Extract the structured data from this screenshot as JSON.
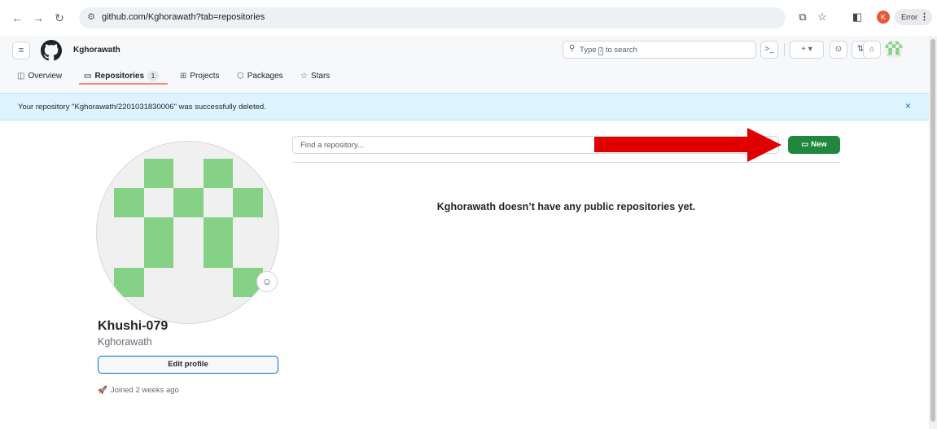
{
  "browser": {
    "url": "github.com/Kghorawath?tab=repositories",
    "profile_initial": "K",
    "error_label": "Error",
    "icons": [
      "back-icon",
      "forward-icon",
      "reload-icon",
      "site-info-icon",
      "install-app-icon",
      "bookmark-star-icon",
      "side-panel-icon",
      "menu-dots-icon"
    ]
  },
  "header": {
    "username": "Kghorawath",
    "search_label": "Type",
    "search_key": "/",
    "search_suffix": "to search",
    "create_label": "+ ▾"
  },
  "tabs": [
    {
      "label": "Overview",
      "icon": "book-icon"
    },
    {
      "label": "Repositories",
      "icon": "repo-icon",
      "count": "1"
    },
    {
      "label": "Projects",
      "icon": "table-icon"
    },
    {
      "label": "Packages",
      "icon": "package-icon"
    },
    {
      "label": "Stars",
      "icon": "star-icon"
    }
  ],
  "flash": {
    "message": "Your repository \"Kghorawath/2201031830006\" was successfully deleted.",
    "close": "×"
  },
  "profile": {
    "name": "Khushi-079",
    "login": "Kghorawath",
    "edit_button": "Edit profile",
    "joined": "Joined 2 weeks ago"
  },
  "repos": {
    "find_placeholder": "Find a repository...",
    "new_button": "New",
    "empty_message": "Kghorawath doesn’t have any public repositories yet."
  },
  "colors": {
    "accent_green": "#1f883d",
    "identicon_green": "#85d185",
    "flash_bg": "#ddf4ff",
    "annotation_arrow": "#e00000",
    "tab_underline": "#fd8c73"
  }
}
